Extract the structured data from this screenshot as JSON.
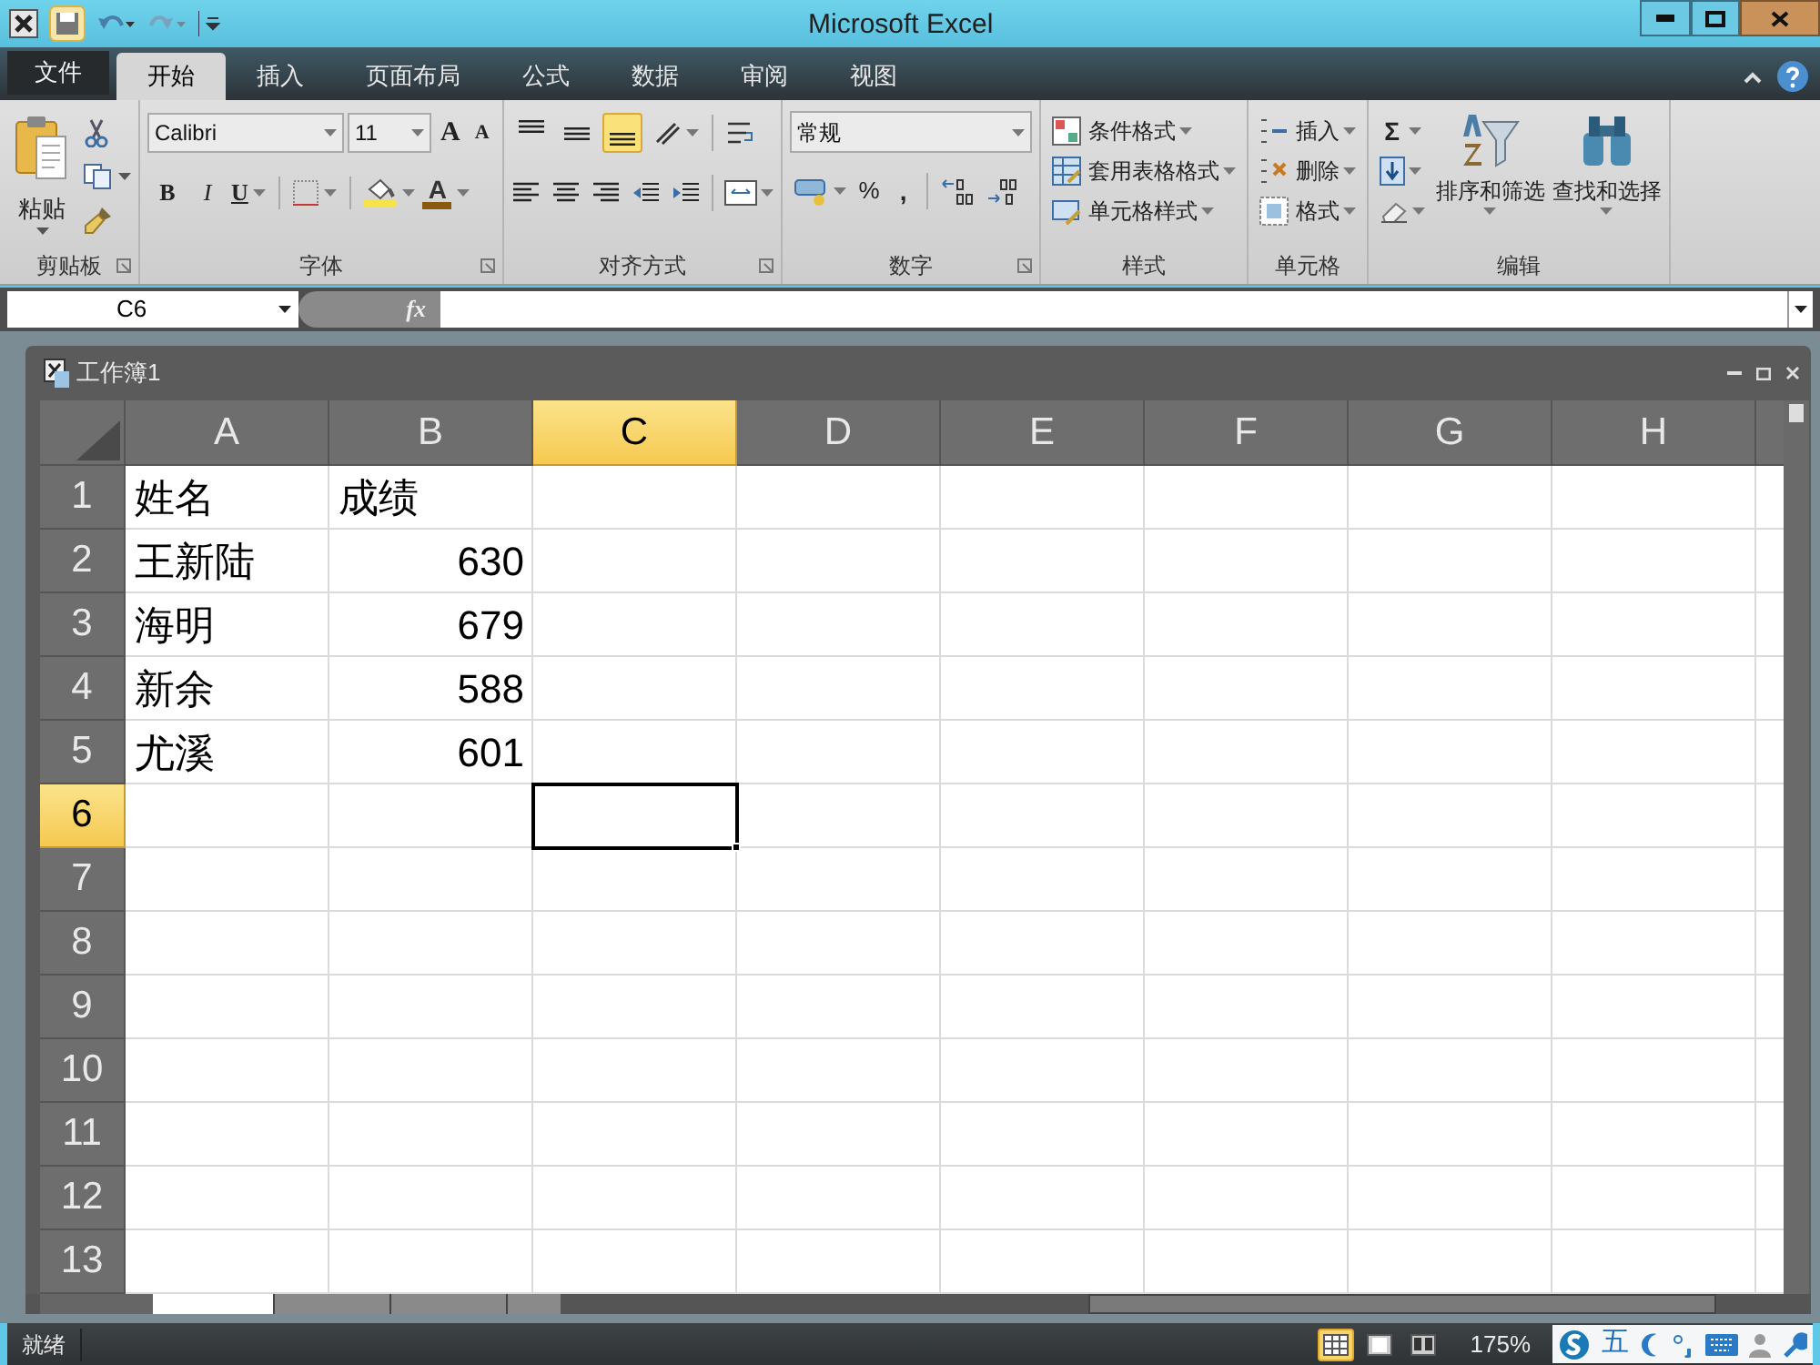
{
  "window": {
    "title": "Microsoft Excel"
  },
  "ribbon_tabs": [
    {
      "label": "文件",
      "kind": "file",
      "selected": false
    },
    {
      "label": "开始",
      "kind": "tab",
      "selected": true
    },
    {
      "label": "插入",
      "kind": "tab",
      "selected": false
    },
    {
      "label": "页面布局",
      "kind": "tab",
      "selected": false
    },
    {
      "label": "公式",
      "kind": "tab",
      "selected": false
    },
    {
      "label": "数据",
      "kind": "tab",
      "selected": false
    },
    {
      "label": "审阅",
      "kind": "tab",
      "selected": false
    },
    {
      "label": "视图",
      "kind": "tab",
      "selected": false
    }
  ],
  "ribbon": {
    "clipboard": {
      "label": "剪贴板",
      "paste": "粘贴"
    },
    "font": {
      "label": "字体",
      "font_name": "Calibri",
      "font_size": "11",
      "grow": "A",
      "shrink": "A",
      "bold": "B",
      "italic": "I",
      "underline": "U",
      "font_color": "A"
    },
    "alignment": {
      "label": "对齐方式",
      "vertical_align": [
        {
          "kind": "top",
          "selected": false
        },
        {
          "kind": "middle",
          "selected": false
        },
        {
          "kind": "bottom",
          "selected": true
        }
      ]
    },
    "number": {
      "label": "数字",
      "format": "常规",
      "percent": "%",
      "comma": ","
    },
    "styles": {
      "label": "样式",
      "items": [
        "条件格式",
        "套用表格格式",
        "单元格样式"
      ]
    },
    "cells": {
      "label": "单元格",
      "items": [
        "插入",
        "删除",
        "格式"
      ]
    },
    "editing": {
      "label": "编辑",
      "sum": "Σ",
      "sort": "排序和筛选",
      "find": "查找和选择"
    }
  },
  "formula_bar": {
    "name_box": "C6",
    "fx": "fx"
  },
  "workbook": {
    "title": "工作簿1",
    "columns": [
      {
        "label": "A",
        "selected": false
      },
      {
        "label": "B",
        "selected": false
      },
      {
        "label": "C",
        "selected": true
      },
      {
        "label": "D",
        "selected": false
      },
      {
        "label": "E",
        "selected": false
      },
      {
        "label": "F",
        "selected": false
      },
      {
        "label": "G",
        "selected": false
      },
      {
        "label": "H",
        "selected": false
      }
    ],
    "rows": [
      {
        "label": "1",
        "selected": false,
        "cells": [
          {
            "text": "姓名",
            "kind": "text",
            "selected": false
          },
          {
            "text": "成绩",
            "kind": "text",
            "selected": false
          },
          {
            "selected": false
          },
          {
            "selected": false
          },
          {
            "selected": false
          },
          {
            "selected": false
          },
          {
            "selected": false
          },
          {
            "selected": false
          }
        ]
      },
      {
        "label": "2",
        "selected": false,
        "cells": [
          {
            "text": "王新陆",
            "kind": "text",
            "selected": false
          },
          {
            "text": "630",
            "kind": "number",
            "selected": false
          },
          {
            "selected": false
          },
          {
            "selected": false
          },
          {
            "selected": false
          },
          {
            "selected": false
          },
          {
            "selected": false
          },
          {
            "selected": false
          }
        ]
      },
      {
        "label": "3",
        "selected": false,
        "cells": [
          {
            "text": "海明",
            "kind": "text",
            "selected": false
          },
          {
            "text": "679",
            "kind": "number",
            "selected": false
          },
          {
            "selected": false
          },
          {
            "selected": false
          },
          {
            "selected": false
          },
          {
            "selected": false
          },
          {
            "selected": false
          },
          {
            "selected": false
          }
        ]
      },
      {
        "label": "4",
        "selected": false,
        "cells": [
          {
            "text": "新余",
            "kind": "text",
            "selected": false
          },
          {
            "text": "588",
            "kind": "number",
            "selected": false
          },
          {
            "selected": false
          },
          {
            "selected": false
          },
          {
            "selected": false
          },
          {
            "selected": false
          },
          {
            "selected": false
          },
          {
            "selected": false
          }
        ]
      },
      {
        "label": "5",
        "selected": false,
        "cells": [
          {
            "text": "尤溪",
            "kind": "text",
            "selected": false
          },
          {
            "text": "601",
            "kind": "number",
            "selected": false
          },
          {
            "selected": false
          },
          {
            "selected": false
          },
          {
            "selected": false
          },
          {
            "selected": false
          },
          {
            "selected": false
          },
          {
            "selected": false
          }
        ]
      },
      {
        "label": "6",
        "selected": true,
        "cells": [
          {
            "selected": false
          },
          {
            "selected": false
          },
          {
            "selected": true
          },
          {
            "selected": false
          },
          {
            "selected": false
          },
          {
            "selected": false
          },
          {
            "selected": false
          },
          {
            "selected": false
          }
        ]
      },
      {
        "label": "7",
        "selected": false,
        "cells": [
          {
            "selected": false
          },
          {
            "selected": false
          },
          {
            "selected": false
          },
          {
            "selected": false
          },
          {
            "selected": false
          },
          {
            "selected": false
          },
          {
            "selected": false
          },
          {
            "selected": false
          }
        ]
      },
      {
        "label": "8",
        "selected": false,
        "cells": [
          {
            "selected": false
          },
          {
            "selected": false
          },
          {
            "selected": false
          },
          {
            "selected": false
          },
          {
            "selected": false
          },
          {
            "selected": false
          },
          {
            "selected": false
          },
          {
            "selected": false
          }
        ]
      },
      {
        "label": "9",
        "selected": false,
        "cells": [
          {
            "selected": false
          },
          {
            "selected": false
          },
          {
            "selected": false
          },
          {
            "selected": false
          },
          {
            "selected": false
          },
          {
            "selected": false
          },
          {
            "selected": false
          },
          {
            "selected": false
          }
        ]
      },
      {
        "label": "10",
        "selected": false,
        "cells": [
          {
            "selected": false
          },
          {
            "selected": false
          },
          {
            "selected": false
          },
          {
            "selected": false
          },
          {
            "selected": false
          },
          {
            "selected": false
          },
          {
            "selected": false
          },
          {
            "selected": false
          }
        ]
      },
      {
        "label": "11",
        "selected": false,
        "cells": [
          {
            "selected": false
          },
          {
            "selected": false
          },
          {
            "selected": false
          },
          {
            "selected": false
          },
          {
            "selected": false
          },
          {
            "selected": false
          },
          {
            "selected": false
          },
          {
            "selected": false
          }
        ]
      },
      {
        "label": "12",
        "selected": false,
        "cells": [
          {
            "selected": false
          },
          {
            "selected": false
          },
          {
            "selected": false
          },
          {
            "selected": false
          },
          {
            "selected": false
          },
          {
            "selected": false
          },
          {
            "selected": false
          },
          {
            "selected": false
          }
        ]
      },
      {
        "label": "13",
        "selected": false,
        "cells": [
          {
            "selected": false
          },
          {
            "selected": false
          },
          {
            "selected": false
          },
          {
            "selected": false
          },
          {
            "selected": false
          },
          {
            "selected": false
          },
          {
            "selected": false
          },
          {
            "selected": false
          }
        ]
      }
    ]
  },
  "sheet_tabs": [
    {
      "selected": true
    },
    {
      "selected": false
    },
    {
      "selected": false
    }
  ],
  "status_bar": {
    "status": "就绪",
    "views": [
      {
        "kind": "normal",
        "selected": true
      },
      {
        "kind": "layout",
        "selected": false
      },
      {
        "kind": "break",
        "selected": false
      }
    ],
    "zoom": "175%",
    "ime": "五"
  }
}
